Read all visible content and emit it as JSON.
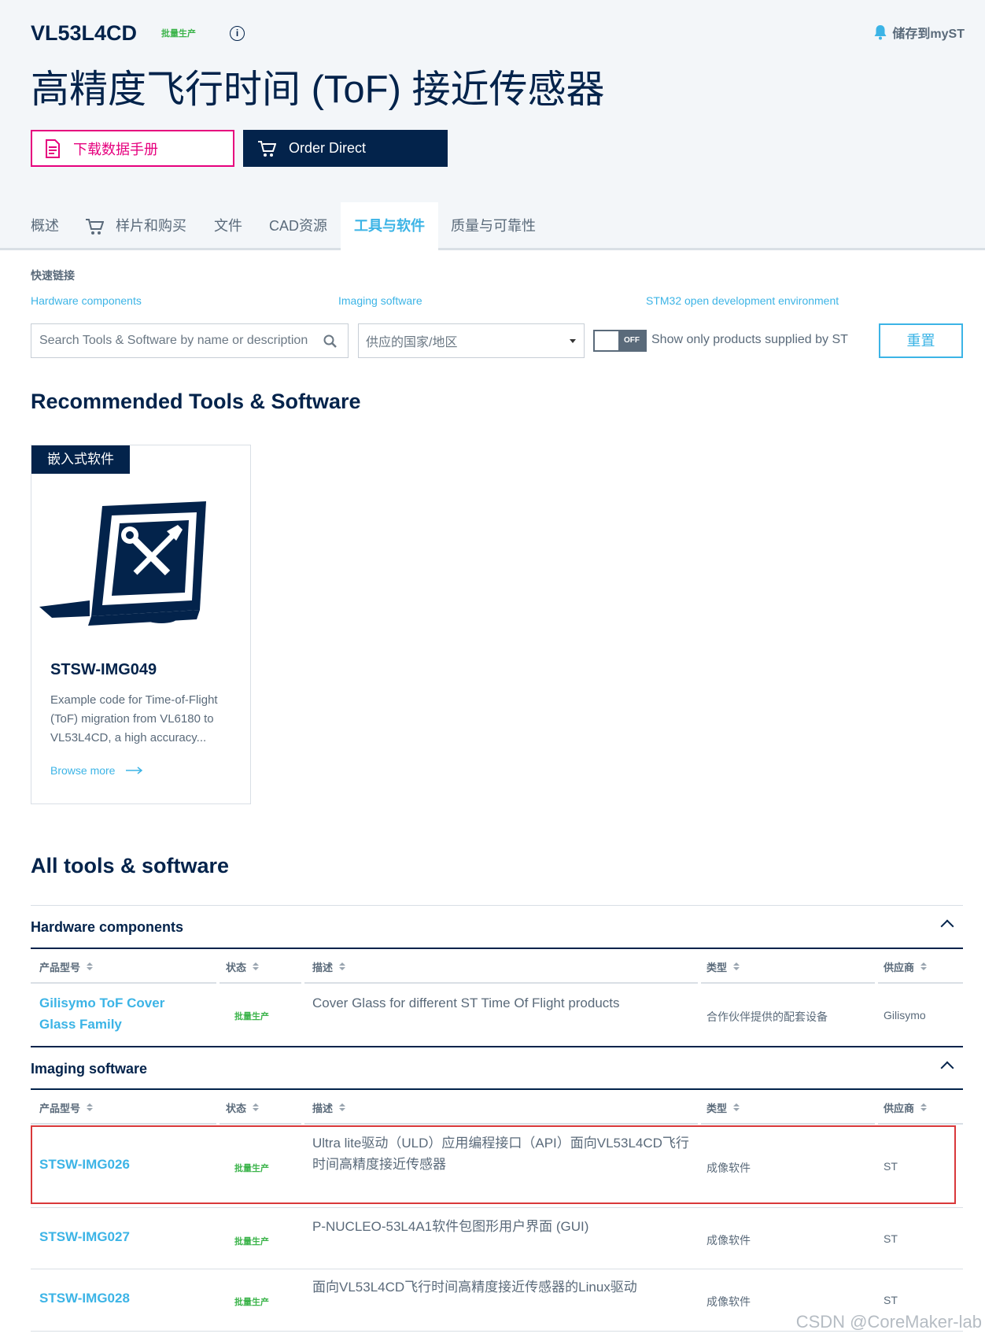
{
  "header": {
    "part_number": "VL53L4CD",
    "status_badge": "批量生产",
    "save_label": "储存到myST",
    "title": "高精度飞行时间 (ToF) 接近传感器",
    "datasheet_button": "下载数据手册",
    "order_button": "Order Direct"
  },
  "tabs": [
    "概述",
    "样片和购买",
    "文件",
    "CAD资源",
    "工具与软件",
    "质量与可靠性"
  ],
  "quick_links": {
    "title": "快速链接",
    "links": [
      "Hardware components",
      "Imaging software",
      "STM32 open development environment"
    ]
  },
  "filters": {
    "search_placeholder": "Search Tools & Software by name or description",
    "country_placeholder": "供应的国家/地区",
    "toggle_state": "OFF",
    "toggle_label": "Show only products supplied by ST",
    "reset_label": "重置"
  },
  "recommended": {
    "heading": "Recommended Tools & Software",
    "card": {
      "tag": "嵌入式软件",
      "name": "STSW-IMG049",
      "description": "Example code for Time-of-Flight (ToF) migration from VL6180 to VL53L4CD, a high accuracy...",
      "link": "Browse more"
    }
  },
  "all_tools": {
    "heading": "All tools & software",
    "columns": [
      "产品型号",
      "状态",
      "描述",
      "类型",
      "供应商"
    ],
    "sections": [
      {
        "title": "Hardware components",
        "rows": [
          {
            "name": "Gilisymo ToF Cover Glass Family",
            "status": "批量生产",
            "description": "Cover Glass for different ST Time Of Flight products",
            "type": "合作伙伴提供的配套设备",
            "supplier": "Gilisymo"
          }
        ]
      },
      {
        "title": "Imaging software",
        "rows": [
          {
            "name": "STSW-IMG026",
            "status": "批量生产",
            "description": "Ultra lite驱动（ULD）应用编程接口（API）面向VL53L4CD飞行时间高精度接近传感器",
            "type": "成像软件",
            "supplier": "ST"
          },
          {
            "name": "STSW-IMG027",
            "status": "批量生产",
            "description": "P-NUCLEO-53L4A1软件包图形用户界面 (GUI)",
            "type": "成像软件",
            "supplier": "ST"
          },
          {
            "name": "STSW-IMG028",
            "status": "批量生产",
            "description": "面向VL53L4CD飞行时间高精度接近传感器的Linux驱动",
            "type": "成像软件",
            "supplier": "ST"
          }
        ]
      }
    ]
  },
  "watermark": "CSDN @CoreMaker-lab"
}
